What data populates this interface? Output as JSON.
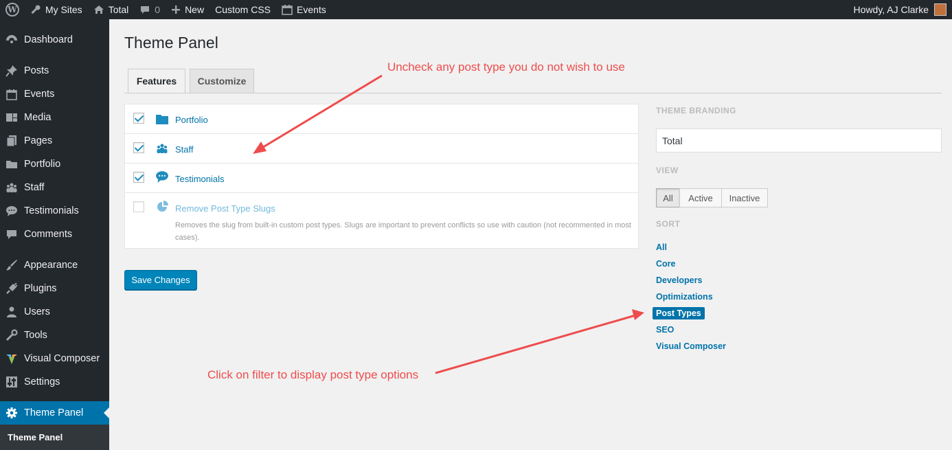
{
  "adminbar": {
    "my_sites": "My Sites",
    "site": "Total",
    "comments_count": "0",
    "new": "New",
    "custom_css": "Custom CSS",
    "events": "Events",
    "greeting": "Howdy, AJ Clarke"
  },
  "sidebar": {
    "items": [
      {
        "label": "Dashboard",
        "icon": "dashboard-icon"
      },
      {
        "label": "Posts",
        "icon": "pin-icon"
      },
      {
        "label": "Events",
        "icon": "calendar-icon"
      },
      {
        "label": "Media",
        "icon": "media-icon"
      },
      {
        "label": "Pages",
        "icon": "pages-icon"
      },
      {
        "label": "Portfolio",
        "icon": "folder-icon"
      },
      {
        "label": "Staff",
        "icon": "group-icon"
      },
      {
        "label": "Testimonials",
        "icon": "speech-bubble-icon"
      },
      {
        "label": "Comments",
        "icon": "comment-icon"
      },
      {
        "label": "Appearance",
        "icon": "brush-icon"
      },
      {
        "label": "Plugins",
        "icon": "plug-icon"
      },
      {
        "label": "Users",
        "icon": "user-icon"
      },
      {
        "label": "Tools",
        "icon": "wrench-icon"
      },
      {
        "label": "Visual Composer",
        "icon": "vc-icon"
      },
      {
        "label": "Settings",
        "icon": "settings-icon"
      },
      {
        "label": "Theme Panel",
        "icon": "gear-icon"
      }
    ],
    "submenu_label": "Theme Panel"
  },
  "main": {
    "title": "Theme Panel",
    "tabs": [
      {
        "label": "Features"
      },
      {
        "label": "Customize"
      }
    ],
    "features": [
      {
        "label": "Portfolio",
        "checked": true,
        "icon": "folder-icon"
      },
      {
        "label": "Staff",
        "checked": true,
        "icon": "group-icon"
      },
      {
        "label": "Testimonials",
        "checked": true,
        "icon": "speech-bubble-icon"
      },
      {
        "label": "Remove Post Type Slugs",
        "checked": false,
        "icon": "pie-icon",
        "description": "Removes the slug from built-in custom post types. Slugs are important to prevent conflicts so use with caution (not recommented in most cases)."
      }
    ],
    "save_label": "Save Changes"
  },
  "panel": {
    "branding_heading": "THEME BRANDING",
    "branding_value": "Total",
    "view_heading": "VIEW",
    "view_options": [
      "All",
      "Active",
      "Inactive"
    ],
    "view_selected": "All",
    "sort_heading": "SORT",
    "sort_options": [
      "All",
      "Core",
      "Developers",
      "Optimizations",
      "Post Types",
      "SEO",
      "Visual Composer"
    ],
    "sort_selected": "Post Types"
  },
  "annotations": {
    "top": "Uncheck any post type you do not wish to use",
    "bottom": "Click on filter to display post type options"
  },
  "colors": {
    "admin_dark": "#23282d",
    "accent": "#0073aa",
    "annotation": "#ee4c4c"
  }
}
